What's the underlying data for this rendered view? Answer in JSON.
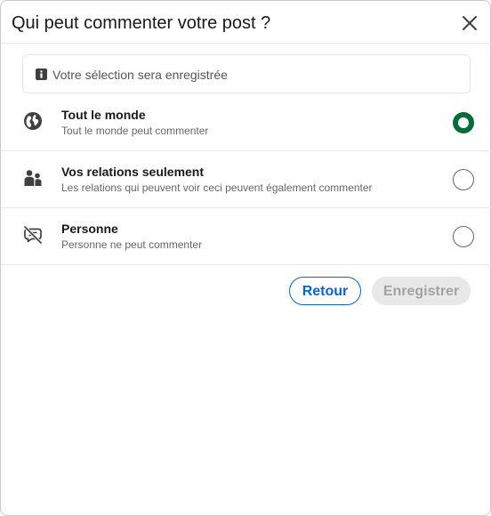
{
  "dialog": {
    "title": "Qui peut commenter votre post ?",
    "close_icon": "close-icon"
  },
  "notice": {
    "icon": "info-icon",
    "text": "Votre sélection sera enregistrée"
  },
  "options": [
    {
      "icon": "globe-icon",
      "title": "Tout le monde",
      "description": "Tout le monde peut commenter",
      "selected": true
    },
    {
      "icon": "people-icon",
      "title": "Vos relations seulement",
      "description": "Les relations qui peuvent voir ceci peuvent également commenter",
      "selected": false
    },
    {
      "icon": "comment-off-icon",
      "title": "Personne",
      "description": "Personne ne peut commenter",
      "selected": false
    }
  ],
  "footer": {
    "back_label": "Retour",
    "save_label": "Enregistrer",
    "save_enabled": false
  },
  "colors": {
    "accent_blue": "#0a66c2",
    "selected_green": "#056b3a",
    "disabled_bg": "#e8e8e8",
    "disabled_text": "#a3a3a3"
  }
}
